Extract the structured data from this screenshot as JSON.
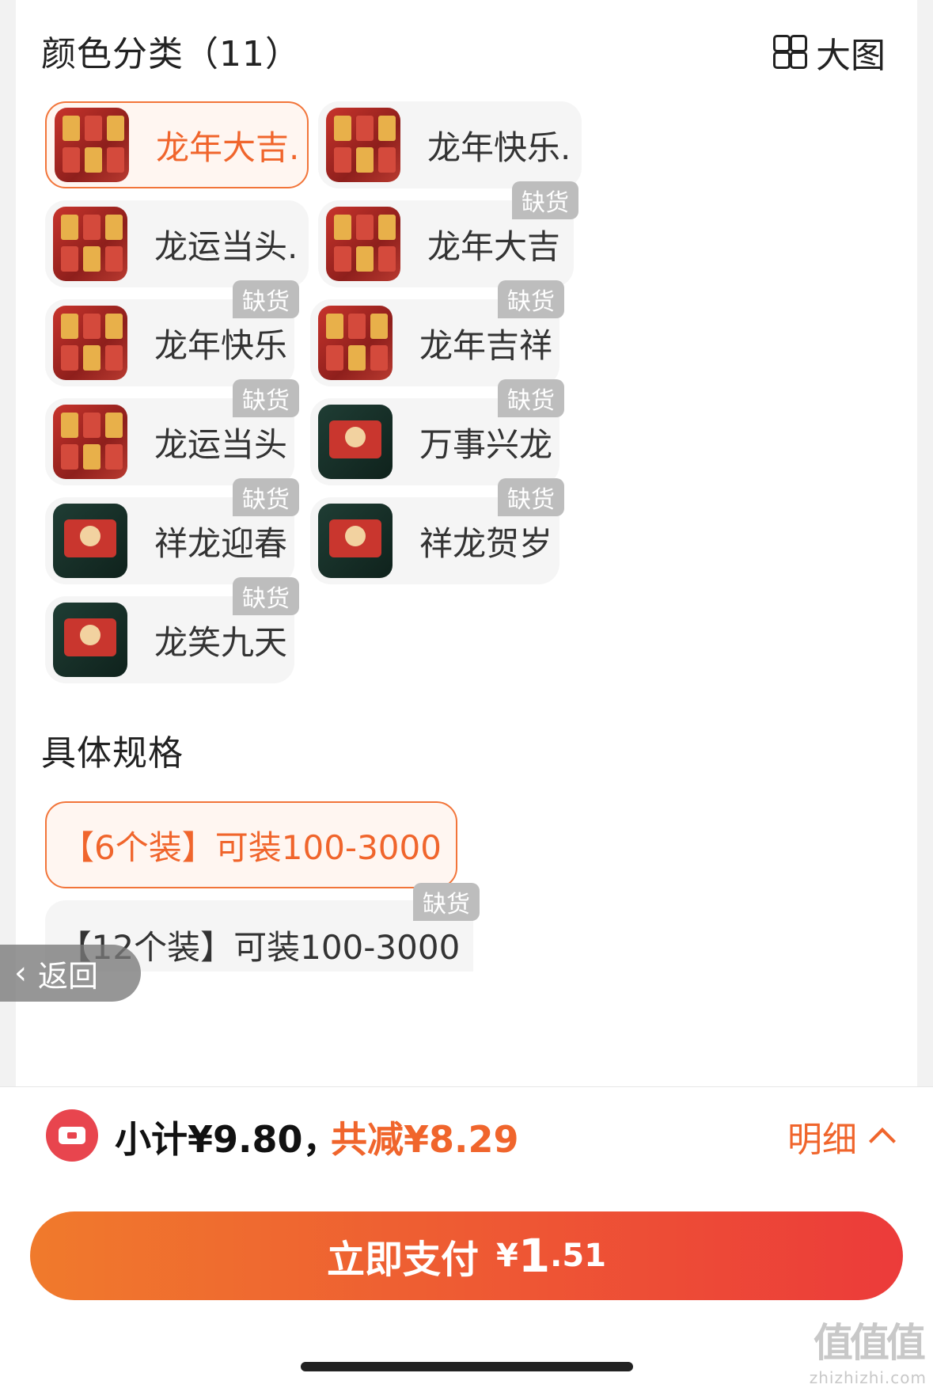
{
  "color_section": {
    "title": "颜色分类（11）",
    "big_image_label": "大图",
    "options": [
      {
        "label": "龙年大吉.",
        "selected": true,
        "out_of_stock": false,
        "thumb": "red-packets"
      },
      {
        "label": "龙年快乐.",
        "selected": false,
        "out_of_stock": false,
        "thumb": "red-packets"
      },
      {
        "label": "龙运当头.",
        "selected": false,
        "out_of_stock": false,
        "thumb": "red-packets"
      },
      {
        "label": "龙年大吉",
        "selected": false,
        "out_of_stock": true,
        "thumb": "red-packets"
      },
      {
        "label": "龙年快乐",
        "selected": false,
        "out_of_stock": true,
        "thumb": "red-packets"
      },
      {
        "label": "龙年吉祥",
        "selected": false,
        "out_of_stock": true,
        "thumb": "red-packets"
      },
      {
        "label": "龙运当头",
        "selected": false,
        "out_of_stock": true,
        "thumb": "red-packets"
      },
      {
        "label": "万事兴龙",
        "selected": false,
        "out_of_stock": true,
        "thumb": "dragon-packet"
      },
      {
        "label": "祥龙迎春",
        "selected": false,
        "out_of_stock": true,
        "thumb": "dragon-packet"
      },
      {
        "label": "祥龙贺岁",
        "selected": false,
        "out_of_stock": true,
        "thumb": "dragon-packet"
      },
      {
        "label": "龙笑九天",
        "selected": false,
        "out_of_stock": true,
        "thumb": "dragon-packet"
      }
    ],
    "badge_text": "缺货"
  },
  "spec_section": {
    "title": "具体规格",
    "options": [
      {
        "label": "【6个装】可装100-3000",
        "selected": true,
        "out_of_stock": false
      },
      {
        "label": "【12个装】可装100-3000",
        "selected": false,
        "out_of_stock": true
      }
    ]
  },
  "back_button": {
    "label": "返回"
  },
  "summary": {
    "subtotal": "小计¥9.80，",
    "saved": "共减¥8.29",
    "detail_label": "明细"
  },
  "pay_button": {
    "label": "立即支付",
    "currency": "¥",
    "amount_int": "1",
    "amount_dec": ".51"
  },
  "watermark": {
    "text": "值值值",
    "domain": "zhizhizhi.com"
  },
  "colors": {
    "accent": "#f0652c",
    "pay_gradient_start": "#f07a2c",
    "pay_gradient_end": "#ec3b3a",
    "badge": "#bdbdbd"
  }
}
